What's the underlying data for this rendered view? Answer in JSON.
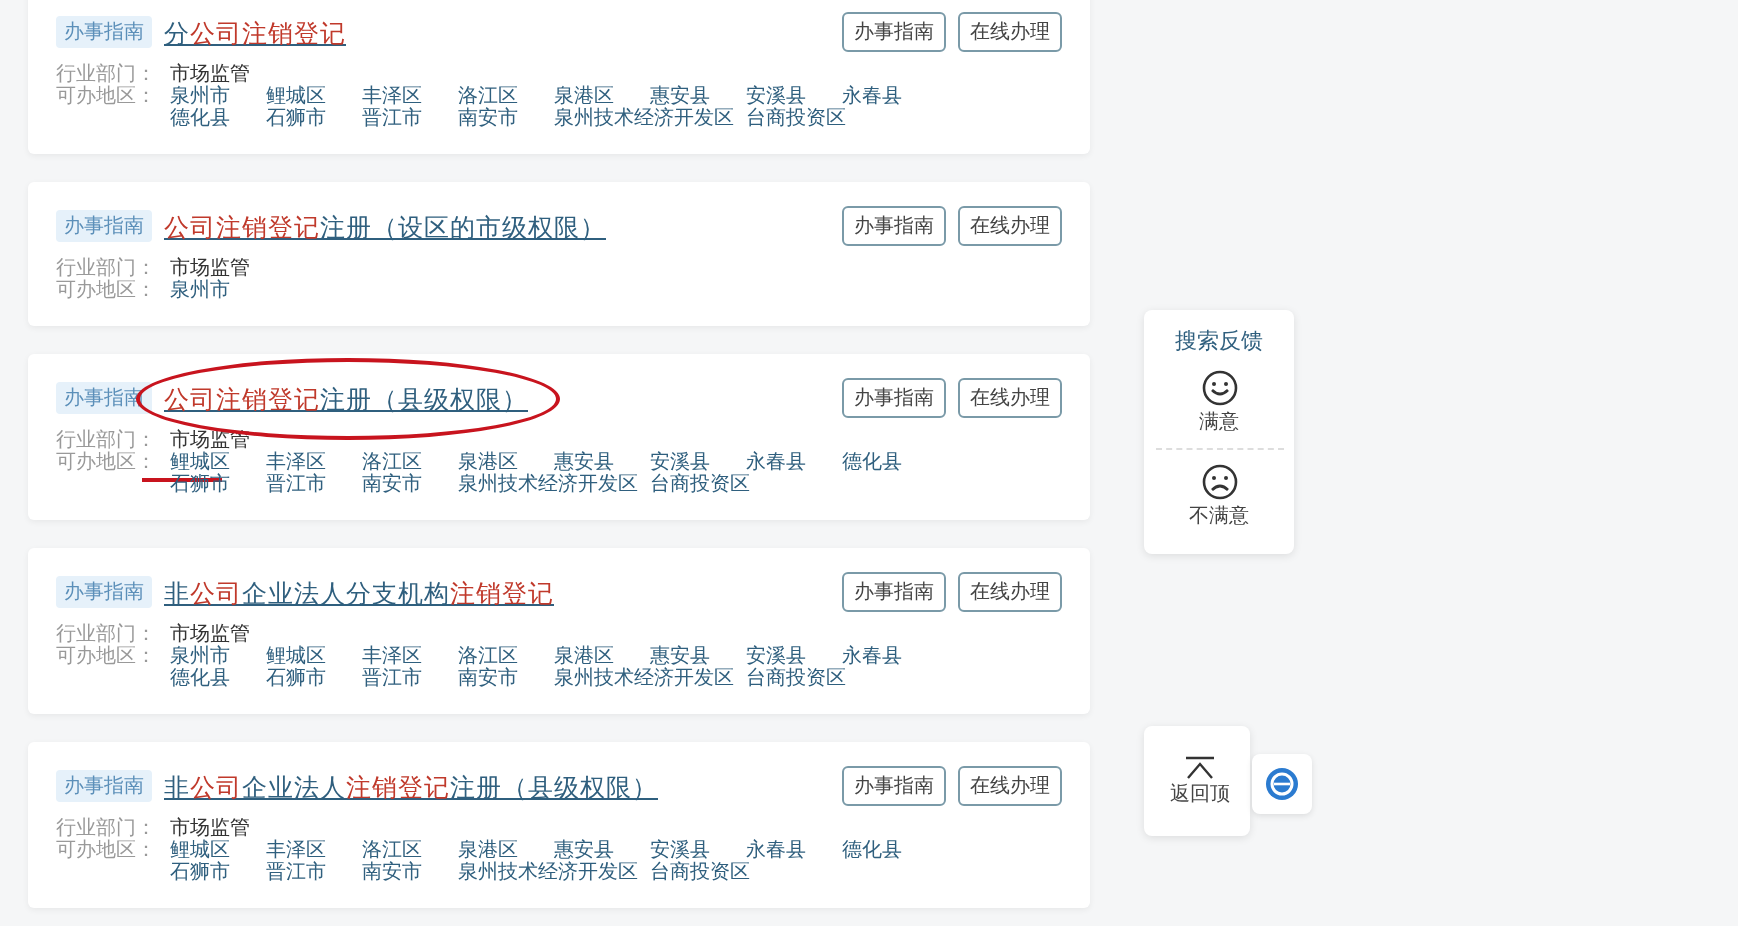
{
  "results": [
    {
      "tag": "办事指南",
      "title": [
        {
          "text": "分",
          "highlight": false
        },
        {
          "text": "公司注销登记",
          "highlight": true
        }
      ],
      "circled": false,
      "dept_label": "行业部门：",
      "dept": "市场监管",
      "area_label": "可办地区：",
      "areas": [
        {
          "name": "泉州市",
          "underlined": false
        },
        {
          "name": "鲤城区",
          "underlined": false
        },
        {
          "name": "丰泽区",
          "underlined": false
        },
        {
          "name": "洛江区",
          "underlined": false
        },
        {
          "name": "泉港区",
          "underlined": false
        },
        {
          "name": "惠安县",
          "underlined": false
        },
        {
          "name": "安溪县",
          "underlined": false
        },
        {
          "name": "永春县",
          "underlined": false
        },
        {
          "name": "德化县",
          "underlined": false
        },
        {
          "name": "石狮市",
          "underlined": false
        },
        {
          "name": "晋江市",
          "underlined": false
        },
        {
          "name": "南安市",
          "underlined": false
        },
        {
          "name": "泉州技术经济开发区",
          "underlined": false
        },
        {
          "name": "台商投资区",
          "underlined": false
        }
      ],
      "buttons": [
        "办事指南",
        "在线办理"
      ]
    },
    {
      "tag": "办事指南",
      "title": [
        {
          "text": "公司注销登记",
          "highlight": true
        },
        {
          "text": "注册（设区的市级权限）",
          "highlight": false
        }
      ],
      "circled": false,
      "dept_label": "行业部门：",
      "dept": "市场监管",
      "area_label": "可办地区：",
      "areas": [
        {
          "name": "泉州市",
          "underlined": false
        }
      ],
      "buttons": [
        "办事指南",
        "在线办理"
      ]
    },
    {
      "tag": "办事指南",
      "title": [
        {
          "text": "公司注销登记",
          "highlight": true
        },
        {
          "text": "注册（县级权限）",
          "highlight": false
        }
      ],
      "circled": true,
      "dept_label": "行业部门：",
      "dept": "市场监管",
      "area_label": "可办地区：",
      "areas": [
        {
          "name": "鲤城区",
          "underlined": true
        },
        {
          "name": "丰泽区",
          "underlined": false
        },
        {
          "name": "洛江区",
          "underlined": false
        },
        {
          "name": "泉港区",
          "underlined": false
        },
        {
          "name": "惠安县",
          "underlined": false
        },
        {
          "name": "安溪县",
          "underlined": false
        },
        {
          "name": "永春县",
          "underlined": false
        },
        {
          "name": "德化县",
          "underlined": false
        },
        {
          "name": "石狮市",
          "underlined": false
        },
        {
          "name": "晋江市",
          "underlined": false
        },
        {
          "name": "南安市",
          "underlined": false
        },
        {
          "name": "泉州技术经济开发区",
          "underlined": false
        },
        {
          "name": "台商投资区",
          "underlined": false
        }
      ],
      "buttons": [
        "办事指南",
        "在线办理"
      ]
    },
    {
      "tag": "办事指南",
      "title": [
        {
          "text": "非",
          "highlight": false
        },
        {
          "text": "公司",
          "highlight": true
        },
        {
          "text": "企业法人分支机构",
          "highlight": false
        },
        {
          "text": "注销登记",
          "highlight": true
        }
      ],
      "circled": false,
      "dept_label": "行业部门：",
      "dept": "市场监管",
      "area_label": "可办地区：",
      "areas": [
        {
          "name": "泉州市",
          "underlined": false
        },
        {
          "name": "鲤城区",
          "underlined": false
        },
        {
          "name": "丰泽区",
          "underlined": false
        },
        {
          "name": "洛江区",
          "underlined": false
        },
        {
          "name": "泉港区",
          "underlined": false
        },
        {
          "name": "惠安县",
          "underlined": false
        },
        {
          "name": "安溪县",
          "underlined": false
        },
        {
          "name": "永春县",
          "underlined": false
        },
        {
          "name": "德化县",
          "underlined": false
        },
        {
          "name": "石狮市",
          "underlined": false
        },
        {
          "name": "晋江市",
          "underlined": false
        },
        {
          "name": "南安市",
          "underlined": false
        },
        {
          "name": "泉州技术经济开发区",
          "underlined": false
        },
        {
          "name": "台商投资区",
          "underlined": false
        }
      ],
      "buttons": [
        "办事指南",
        "在线办理"
      ]
    },
    {
      "tag": "办事指南",
      "title": [
        {
          "text": "非",
          "highlight": false
        },
        {
          "text": "公司",
          "highlight": true
        },
        {
          "text": "企业法人",
          "highlight": false
        },
        {
          "text": "注销登记",
          "highlight": true
        },
        {
          "text": "注册（县级权限）",
          "highlight": false
        }
      ],
      "circled": false,
      "dept_label": "行业部门：",
      "dept": "市场监管",
      "area_label": "可办地区：",
      "areas": [
        {
          "name": "鲤城区",
          "underlined": false
        },
        {
          "name": "丰泽区",
          "underlined": false
        },
        {
          "name": "洛江区",
          "underlined": false
        },
        {
          "name": "泉港区",
          "underlined": false
        },
        {
          "name": "惠安县",
          "underlined": false
        },
        {
          "name": "安溪县",
          "underlined": false
        },
        {
          "name": "永春县",
          "underlined": false
        },
        {
          "name": "德化县",
          "underlined": false
        },
        {
          "name": "石狮市",
          "underlined": false
        },
        {
          "name": "晋江市",
          "underlined": false
        },
        {
          "name": "南安市",
          "underlined": false
        },
        {
          "name": "泉州技术经济开发区",
          "underlined": false
        },
        {
          "name": "台商投资区",
          "underlined": false
        }
      ],
      "buttons": [
        "办事指南",
        "在线办理"
      ]
    }
  ],
  "feedback": {
    "title": "搜索反馈",
    "options": [
      {
        "kind": "happy",
        "label": "满意"
      },
      {
        "kind": "sad",
        "label": "不满意"
      }
    ]
  },
  "back_to_top": {
    "label": "返回顶"
  }
}
